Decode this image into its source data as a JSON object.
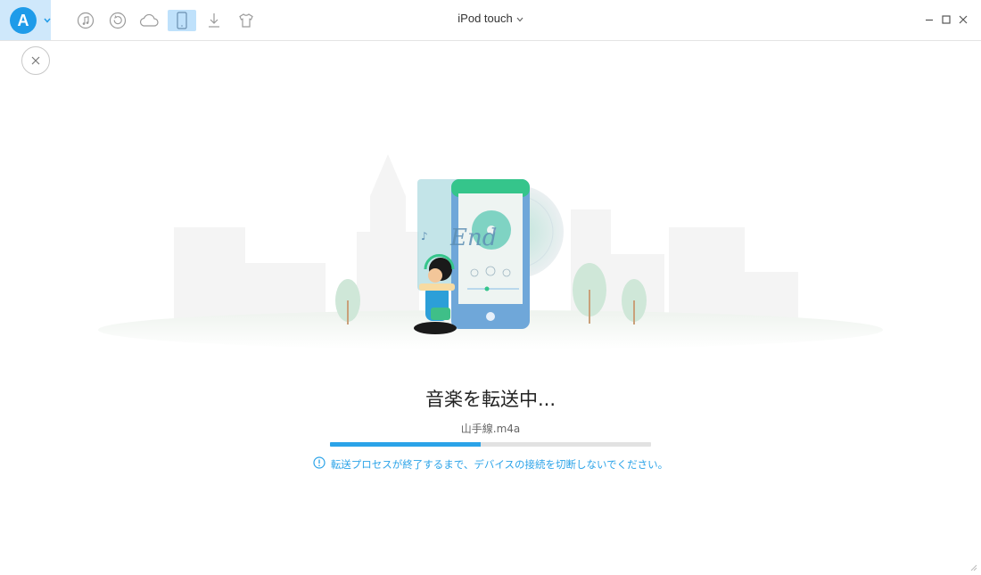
{
  "toolbar": {
    "logo_letter": "A",
    "device_name": "iPod touch",
    "icons": [
      {
        "name": "music-icon"
      },
      {
        "name": "restore-icon"
      },
      {
        "name": "cloud-icon"
      },
      {
        "name": "device-icon",
        "active": true
      },
      {
        "name": "download-icon"
      },
      {
        "name": "tshirt-icon"
      }
    ]
  },
  "window": {
    "accent": "#1e9be9"
  },
  "transfer": {
    "title": "音楽を転送中...",
    "file": "山手線.m4a",
    "progress_percent": 47,
    "warning": "転送プロセスが終了するまで、デバイスの接続を切断しないでください。"
  },
  "illustration": {
    "album_text": "End"
  }
}
